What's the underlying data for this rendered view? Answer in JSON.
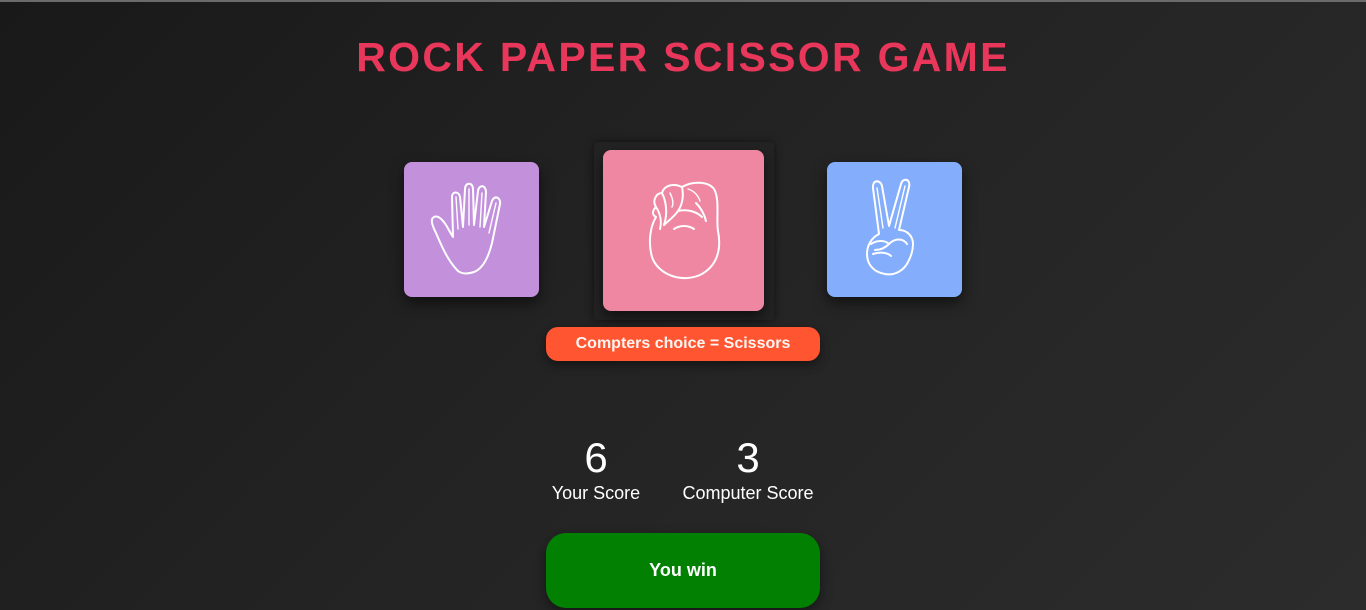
{
  "title": "ROCK PAPER SCISSOR GAME",
  "colors": {
    "title": "#e8375a",
    "paper": "#c390dc",
    "rock": "#ef87a3",
    "scissors": "#84adfc",
    "message_bg": "#ff5530",
    "result_bg": "#018001",
    "background": "#232323"
  },
  "choices": [
    {
      "id": "paper",
      "icon": "open-hand-icon",
      "selected": false
    },
    {
      "id": "rock",
      "icon": "fist-icon",
      "selected": true
    },
    {
      "id": "scissors",
      "icon": "peace-sign-hand-icon",
      "selected": false
    }
  ],
  "message": "Compters choice = Scissors",
  "scores": {
    "user": {
      "value": "6",
      "label": "Your Score"
    },
    "computer": {
      "value": "3",
      "label": "Computer Score"
    }
  },
  "result": "You win"
}
